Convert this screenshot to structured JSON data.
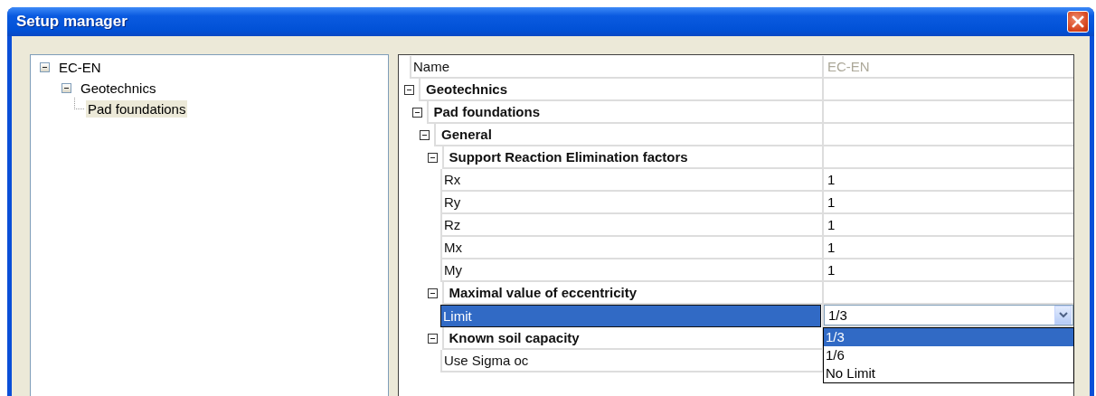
{
  "window": {
    "title": "Setup manager"
  },
  "tree": {
    "items": [
      {
        "label": "EC-EN",
        "expanded": true,
        "selected": false,
        "children": [
          {
            "label": "Geotechnics",
            "expanded": true,
            "selected": false,
            "children": [
              {
                "label": "Pad foundations",
                "selected": true
              }
            ]
          }
        ]
      }
    ]
  },
  "property_grid": {
    "rows": [
      {
        "kind": "property",
        "name": "Name",
        "value": "EC-EN",
        "readonly": true,
        "selected": false
      },
      {
        "kind": "category",
        "name": "Geotechnics",
        "expanded": true,
        "children": [
          {
            "kind": "category",
            "name": "Pad foundations",
            "expanded": true,
            "children": [
              {
                "kind": "category",
                "name": "General",
                "expanded": true,
                "children": [
                  {
                    "kind": "category",
                    "name": "Support Reaction Elimination factors",
                    "expanded": true,
                    "children": [
                      {
                        "kind": "property",
                        "name": "Rx",
                        "value": "1",
                        "selected": false
                      },
                      {
                        "kind": "property",
                        "name": "Ry",
                        "value": "1",
                        "selected": false
                      },
                      {
                        "kind": "property",
                        "name": "Rz",
                        "value": "1",
                        "selected": false
                      },
                      {
                        "kind": "property",
                        "name": "Mx",
                        "value": "1",
                        "selected": false
                      },
                      {
                        "kind": "property",
                        "name": "My",
                        "value": "1",
                        "selected": false
                      }
                    ]
                  },
                  {
                    "kind": "category",
                    "name": "Maximal value of eccentricity",
                    "expanded": true,
                    "children": [
                      {
                        "kind": "dropdown",
                        "name": "Limit",
                        "value": "1/3",
                        "selected": true,
                        "options": [
                          {
                            "label": "1/3",
                            "selected": true
                          },
                          {
                            "label": "1/6",
                            "selected": false
                          },
                          {
                            "label": "No Limit",
                            "selected": false
                          }
                        ]
                      }
                    ]
                  },
                  {
                    "kind": "category",
                    "name": "Known soil capacity",
                    "expanded": true,
                    "children": [
                      {
                        "kind": "property",
                        "name": "Use Sigma oc",
                        "selected": false
                      }
                    ]
                  }
                ]
              }
            ]
          }
        ]
      }
    ]
  }
}
